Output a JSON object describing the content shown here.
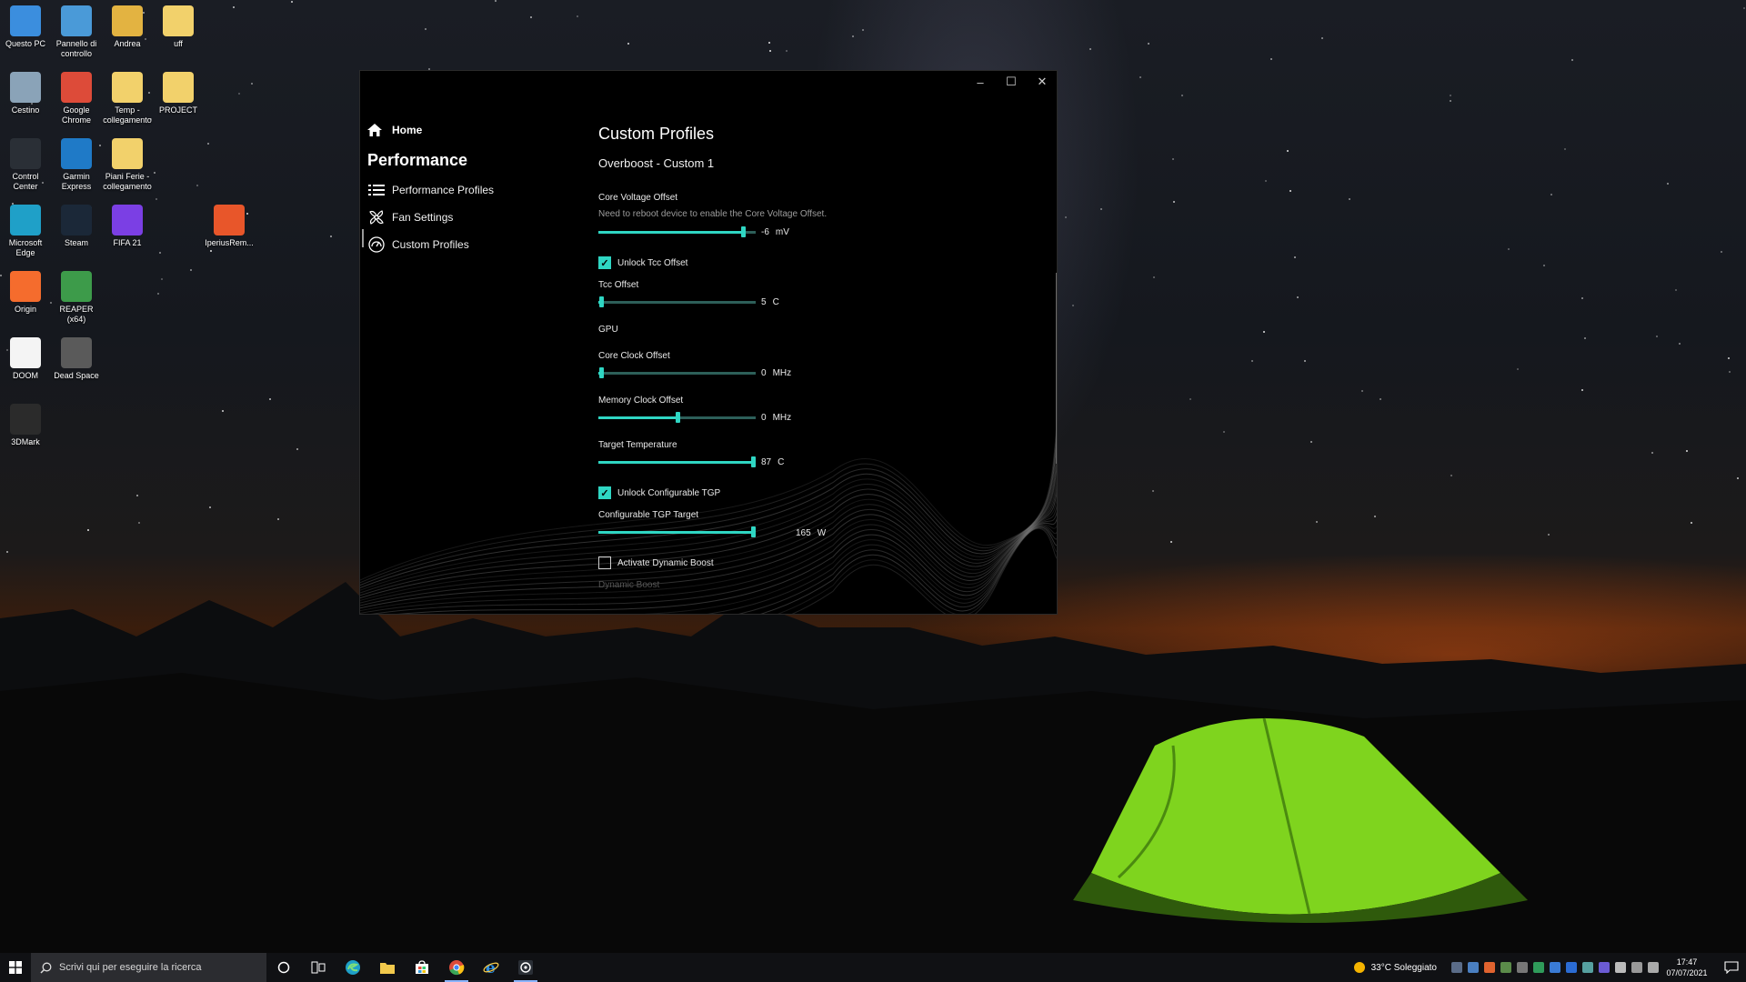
{
  "desktop": {
    "icons": [
      {
        "label": "Questo PC",
        "icon": "computer-icon",
        "color": "#3b8ede"
      },
      {
        "label": "Pannello di controllo",
        "icon": "control-panel-icon",
        "color": "#4a9ad8"
      },
      {
        "label": "Andrea",
        "icon": "user-folder-icon",
        "color": "#e3b341"
      },
      {
        "label": "uff",
        "icon": "folder-icon",
        "color": "#f2d16b"
      },
      {
        "label": "Cestino",
        "icon": "recycle-bin-icon",
        "color": "#8aa3b8"
      },
      {
        "label": "Google Chrome",
        "icon": "chrome-icon",
        "color": "#dd4b39"
      },
      {
        "label": "Temp - collegamento",
        "icon": "folder-shortcut-icon",
        "color": "#f2d16b"
      },
      {
        "label": "PROJECT",
        "icon": "folder-icon",
        "color": "#f2d16b"
      },
      {
        "label": "Control Center",
        "icon": "control-center-icon",
        "color": "#2a2f36"
      },
      {
        "label": "Garmin Express",
        "icon": "garmin-icon",
        "color": "#1f7ac7"
      },
      {
        "label": "Piani Ferie - collegamento",
        "icon": "document-shortcut-icon",
        "color": "#f2d16b"
      },
      {
        "label": "Microsoft Edge",
        "icon": "edge-icon",
        "color": "#1fa0c8"
      },
      {
        "label": "Steam",
        "icon": "steam-icon",
        "color": "#1b2838"
      },
      {
        "label": "FIFA 21",
        "icon": "fifa-icon",
        "color": "#7b3fe4"
      },
      {
        "label": "IperiusRem...",
        "icon": "iperius-icon",
        "color": "#e8562a"
      },
      {
        "label": "Origin",
        "icon": "origin-icon",
        "color": "#f56c2d"
      },
      {
        "label": "REAPER (x64)",
        "icon": "reaper-icon",
        "color": "#3d9b4a"
      },
      {
        "label": "DOOM",
        "icon": "document-icon",
        "color": "#f4f4f4"
      },
      {
        "label": "Dead Space",
        "icon": "dead-space-icon",
        "color": "#5a5a5a"
      },
      {
        "label": "3DMark",
        "icon": "3dmark-icon",
        "color": "#2b2b2b"
      }
    ]
  },
  "window": {
    "caption": {
      "minimize": "–",
      "maximize": "☐",
      "close": "✕"
    },
    "nav": {
      "home": "Home",
      "section": "Performance",
      "items": [
        {
          "label": "Performance Profiles",
          "icon": "list-icon"
        },
        {
          "label": "Fan Settings",
          "icon": "fan-icon"
        },
        {
          "label": "Custom Profiles",
          "icon": "gauge-icon"
        }
      ]
    },
    "content": {
      "title": "Custom Profiles",
      "profile": "Overboost - Custom 1",
      "core_voltage": {
        "label": "Core Voltage Offset",
        "hint": "Need to reboot device to enable the Core Voltage Offset.",
        "value": "-6",
        "unit": "mV",
        "fraction": 0.92
      },
      "unlock_tcc": {
        "label": "Unlock Tcc Offset",
        "checked": true
      },
      "tcc_offset": {
        "label": "Tcc Offset",
        "value": "5",
        "unit": "C",
        "fraction": 0.02
      },
      "gpu_header": "GPU",
      "core_clock": {
        "label": "Core Clock Offset",
        "value": "0",
        "unit": "MHz",
        "fraction": 0.02
      },
      "memory_clock": {
        "label": "Memory Clock Offset",
        "value": "0",
        "unit": "MHz",
        "fraction": 0.5
      },
      "target_temp": {
        "label": "Target Temperature",
        "value": "87",
        "unit": "C",
        "fraction": 0.98
      },
      "unlock_tgp": {
        "label": "Unlock Configurable TGP",
        "checked": true
      },
      "tgp_target": {
        "label": "Configurable TGP Target",
        "value": "165",
        "unit": "W",
        "fraction": 1.0
      },
      "dynamic_boost_check": {
        "label": "Activate Dynamic Boost",
        "checked": false
      },
      "dynamic_boost_label": "Dynamic Boost"
    },
    "accent_color": "#2fd6c3"
  },
  "taskbar": {
    "search_placeholder": "Scrivi qui per eseguire la ricerca",
    "apps": [
      "cortana-icon",
      "task-view-icon",
      "edge-icon",
      "file-explorer-icon",
      "store-icon",
      "chrome-icon",
      "internet-explorer-icon",
      "control-center-icon"
    ],
    "weather": "33°C  Soleggiato",
    "time": "17:47",
    "date": "07/07/2021"
  }
}
